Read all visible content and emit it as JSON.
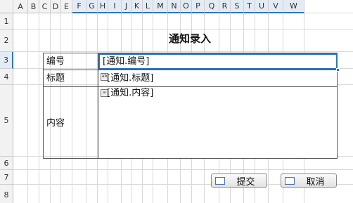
{
  "sheet": {
    "columns": [
      "A",
      "B",
      "C",
      "D",
      "E",
      "F",
      "G",
      "H",
      "I",
      "J",
      "K",
      "L",
      "M",
      "N",
      "O",
      "P",
      "Q",
      "R",
      "S",
      "T",
      "U",
      "V",
      "W"
    ],
    "rows": [
      "1",
      "2",
      "3",
      "4",
      "5",
      "6",
      "7",
      "8"
    ],
    "active_row": "3",
    "active_columns": [
      "F",
      "G",
      "H",
      "I",
      "J",
      "K",
      "L",
      "M",
      "N",
      "O",
      "P",
      "Q",
      "R",
      "S",
      "T",
      "U",
      "V",
      "W"
    ],
    "header_accent_color": "#2e75b6",
    "selection_color": "#2e75b6"
  },
  "form": {
    "title": "通知录入",
    "fields": [
      {
        "label": "编号",
        "value": "[通知.编号]"
      },
      {
        "label": "标题",
        "value": "[通知.标题]",
        "icon": "text-field-icon"
      },
      {
        "label": "内容",
        "value": "[通知.内容]",
        "icon": "memo-field-icon"
      }
    ]
  },
  "buttons": {
    "submit_label": "提交",
    "cancel_label": "取消"
  }
}
